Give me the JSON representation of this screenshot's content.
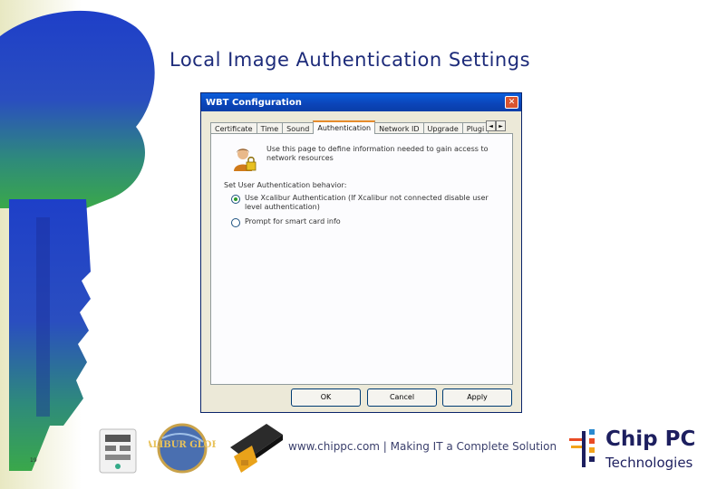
{
  "slide": {
    "title": "Local Image Authentication Settings",
    "page_number": "19",
    "tagline": "www.chippc.com | Making IT a Complete Solution",
    "xcalibur_badge": "XCALIBUR GLOBAL"
  },
  "logo": {
    "brand": "Chip PC",
    "subtitle": "Technologies"
  },
  "window": {
    "title": "WBT Configuration",
    "close_glyph": "✕"
  },
  "tabs": [
    {
      "label": "Certificate",
      "active": false
    },
    {
      "label": "Time",
      "active": false
    },
    {
      "label": "Sound",
      "active": false
    },
    {
      "label": "Authentication",
      "active": true
    },
    {
      "label": "Network ID",
      "active": false
    },
    {
      "label": "Upgrade",
      "active": false
    },
    {
      "label": "Plugi",
      "active": false
    }
  ],
  "tab_scroll": {
    "left": "◄",
    "right": "►"
  },
  "panel": {
    "description": "Use this page to define information needed to gain access to network resources",
    "behavior_label": "Set User Authentication behavior:",
    "options": [
      {
        "label": "Use Xcalibur Authentication (If Xcalibur not connected disable user level authentication)",
        "checked": true
      },
      {
        "label": "Prompt for smart card info",
        "checked": false
      }
    ]
  },
  "buttons": {
    "ok": "OK",
    "cancel": "Cancel",
    "apply": "Apply"
  },
  "colors": {
    "title_blue": "#1d2b7a",
    "titlebar_blue": "#0b44b8",
    "brand_navy": "#1d1f5f"
  }
}
